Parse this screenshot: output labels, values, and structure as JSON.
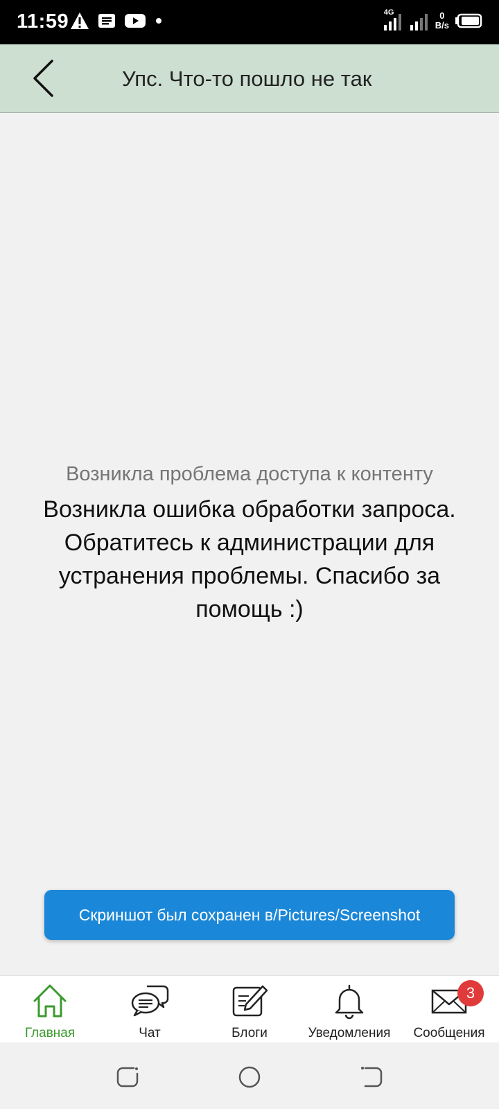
{
  "status_bar": {
    "time": "11:59",
    "network": "4G",
    "speed_value": "0",
    "speed_unit": "B/s"
  },
  "header": {
    "title": "Упс. Что-то пошло не так"
  },
  "content": {
    "subtitle": "Возникла проблема доступа к контенту",
    "message": "Возникла ошибка обработки запроса. Обратитесь к администрации для устранения проблемы. Спасибо за помощь :)"
  },
  "toast": {
    "text": "Скриншот был сохранен в/Pictures/Screenshot"
  },
  "bottom_nav": {
    "items": [
      {
        "label": "Главная",
        "icon": "home-icon",
        "active": true
      },
      {
        "label": "Чат",
        "icon": "chat-icon"
      },
      {
        "label": "Блоги",
        "icon": "blog-edit-icon"
      },
      {
        "label": "Уведомления",
        "icon": "bell-icon"
      },
      {
        "label": "Сообщения",
        "icon": "envelope-icon",
        "badge": "3"
      }
    ]
  },
  "colors": {
    "header_bg": "#cddfd0",
    "accent_green": "#3a9a2e",
    "toast_blue": "#1a87d8",
    "badge_red": "#e03a3a"
  }
}
